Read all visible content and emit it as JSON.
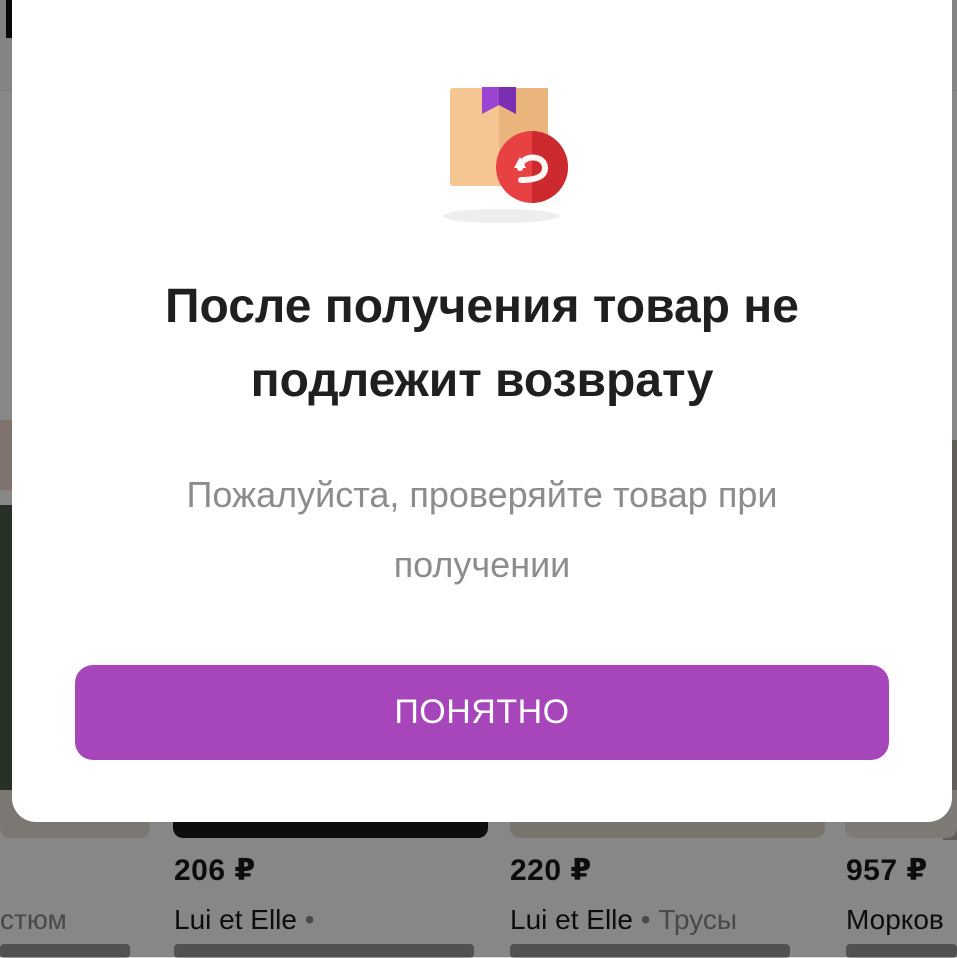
{
  "modal": {
    "title": "После получения товар не подлежит возврату",
    "subtitle": "Пожалуйста, проверяйте товар при получении",
    "confirm_label": "ПОНЯТНО",
    "icon": "box-return-icon",
    "accent_color": "#a746bb"
  },
  "products": [
    {
      "desc_tail": "стюм"
    },
    {
      "price": "206 ₽",
      "brand": "Lui et Elle",
      "sep": "•",
      "type": ""
    },
    {
      "price": "220 ₽",
      "brand": "Lui et Elle",
      "sep": "•",
      "type": "Трусы"
    },
    {
      "price": "957 ₽",
      "brand": "Морков"
    }
  ]
}
